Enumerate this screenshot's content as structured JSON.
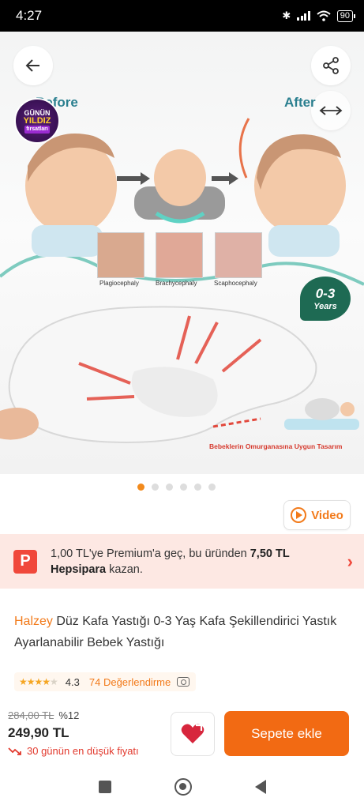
{
  "status": {
    "time": "4:27",
    "battery": "90"
  },
  "gallery": {
    "badge": {
      "line1": "GÜNÜN",
      "line2": "YILDIZ",
      "line3": "fırsatları"
    },
    "before_label": "Before",
    "after_label": "After",
    "conditions": [
      "Plagiocephaly",
      "Brachycephaly",
      "Scaphocephaly"
    ],
    "age_badge": {
      "main": "0-3",
      "sub": "Years"
    },
    "caption": "Bebeklerin Omurganasına Uygun Tasarım",
    "image_count": 6,
    "active_index": 0
  },
  "video_label": "Video",
  "promo": {
    "logo": "P",
    "text_prefix": "1,00 TL'ye Premium'a geç, bu üründen ",
    "amount": "7,50 TL",
    "wallet": "Hepsipara",
    "text_suffix": " kazan."
  },
  "product": {
    "brand": "Halzey",
    "name": " Düz Kafa Yastığı 0-3 Yaş Kafa Şekillendirici Yastık Ayarlanabilir Bebek Yastığı"
  },
  "rating": {
    "score": "4.3",
    "stars": 4.3,
    "reviews": "74 Değerlendirme"
  },
  "price": {
    "old": "284,00 TL",
    "discount": "%12",
    "current": "249,90 TL",
    "lowest_note": "30 günün en düşük fiyatı"
  },
  "cart_label": "Sepete ekle",
  "colors": {
    "accent": "#f26a13",
    "promo_bg": "#fde8e3",
    "discount_red": "#e23a2e"
  }
}
